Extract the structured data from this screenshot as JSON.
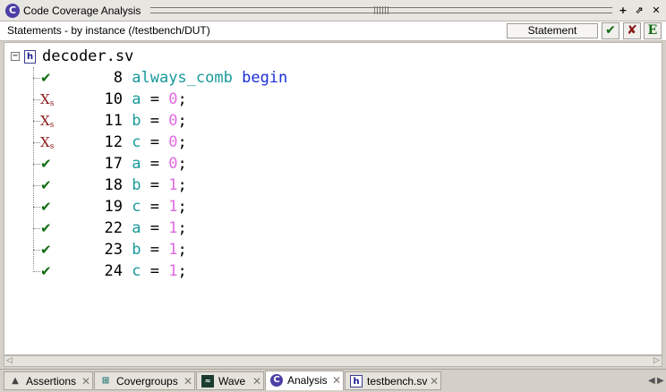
{
  "window": {
    "title": "Code Coverage Analysis",
    "buttons": {
      "add": "+",
      "undock": "⇗",
      "close": "✕"
    }
  },
  "toolbar": {
    "header": "Statements - by instance (/testbench/DUT)",
    "filter_value": "Statement",
    "hit_symbol": "✔",
    "miss_symbol": "✘",
    "exclusion_symbol": "E"
  },
  "tree": {
    "expander": "−",
    "root": {
      "icon": "h",
      "label": "decoder.sv"
    },
    "header_line": {
      "number": "8",
      "kw1": "always_comb",
      "kw2": "begin"
    },
    "statements": [
      {
        "status": "miss",
        "number": "10",
        "var": "a",
        "op": " = ",
        "value": "0",
        "end": ";"
      },
      {
        "status": "miss",
        "number": "11",
        "var": "b",
        "op": " = ",
        "value": "0",
        "end": ";"
      },
      {
        "status": "miss",
        "number": "12",
        "var": "c",
        "op": " = ",
        "value": "0",
        "end": ";"
      },
      {
        "status": "hit",
        "number": "17",
        "var": "a",
        "op": " = ",
        "value": "0",
        "end": ";"
      },
      {
        "status": "hit",
        "number": "18",
        "var": "b",
        "op": " = ",
        "value": "1",
        "end": ";"
      },
      {
        "status": "hit",
        "number": "19",
        "var": "c",
        "op": " = ",
        "value": "1",
        "end": ";"
      },
      {
        "status": "hit",
        "number": "22",
        "var": "a",
        "op": " = ",
        "value": "1",
        "end": ";"
      },
      {
        "status": "hit",
        "number": "23",
        "var": "b",
        "op": " = ",
        "value": "1",
        "end": ";"
      },
      {
        "status": "hit",
        "number": "24",
        "var": "c",
        "op": " = ",
        "value": "1",
        "end": ";"
      }
    ],
    "status_glyphs": {
      "hit": "✔",
      "miss": "X",
      "miss_sub": "s"
    }
  },
  "scrollbar": {
    "left": "◁",
    "right": "▷"
  },
  "tabs": [
    {
      "label": "Assertions",
      "icon": "assertion-icon",
      "active": false
    },
    {
      "label": "Covergroups",
      "icon": "covergroup-icon",
      "active": false
    },
    {
      "label": "Wave",
      "icon": "wave-icon",
      "active": false
    },
    {
      "label": "Analysis",
      "icon": "analysis-icon",
      "active": true
    },
    {
      "label": "testbench.sv",
      "icon": "source-file-icon",
      "active": false
    }
  ],
  "tab_close": "✕",
  "tab_nav": {
    "prev": "◀",
    "next": "▶"
  },
  "colors": {
    "keyword_teal": "#17999b",
    "keyword_blue": "#1a2ed6",
    "number": "#e26ae2",
    "hit": "#0f6b11",
    "miss": "#8a1a1a"
  }
}
